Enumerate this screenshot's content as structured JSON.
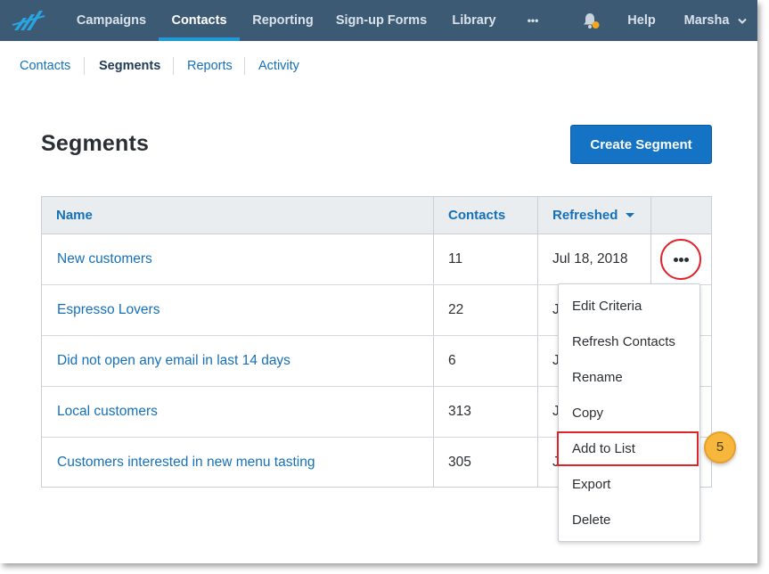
{
  "nav": {
    "items": [
      {
        "label": "Campaigns"
      },
      {
        "label": "Contacts"
      },
      {
        "label": "Reporting"
      },
      {
        "label": "Sign-up Forms"
      },
      {
        "label": "Library"
      },
      {
        "label": "•••"
      }
    ],
    "help": "Help",
    "user": "Marsha",
    "active": "Contacts",
    "notification_dot_color": "#f5a623"
  },
  "subnav": {
    "items": [
      {
        "label": "Contacts"
      },
      {
        "label": "Segments"
      },
      {
        "label": "Reports"
      },
      {
        "label": "Activity"
      }
    ],
    "active": "Segments"
  },
  "page": {
    "title": "Segments",
    "create_button": "Create Segment"
  },
  "table": {
    "columns": {
      "name": "Name",
      "contacts": "Contacts",
      "refreshed": "Refreshed"
    },
    "sort_column": "Refreshed",
    "rows": [
      {
        "name": "New customers",
        "contacts": "11",
        "refreshed": "Jul 18, 2018"
      },
      {
        "name": "Espresso Lovers",
        "contacts": "22",
        "refreshed": "J"
      },
      {
        "name": "Did not open any email in last 14 days",
        "contacts": "6",
        "refreshed": "J"
      },
      {
        "name": "Local customers",
        "contacts": "313",
        "refreshed": "J"
      },
      {
        "name": "Customers interested in new menu tasting",
        "contacts": "305",
        "refreshed": "J"
      }
    ]
  },
  "menu": {
    "items": [
      {
        "label": "Edit Criteria"
      },
      {
        "label": "Refresh Contacts"
      },
      {
        "label": "Rename"
      },
      {
        "label": "Copy"
      },
      {
        "label": "Add to List"
      },
      {
        "label": "Export"
      },
      {
        "label": "Delete"
      }
    ],
    "highlighted": "Add to List"
  },
  "callout": {
    "step": "5"
  },
  "colors": {
    "nav_bg": "#3d5a74",
    "accent": "#1573c5",
    "link": "#1570b8",
    "highlight": "#e0242c",
    "badge": "#f6b73c"
  }
}
